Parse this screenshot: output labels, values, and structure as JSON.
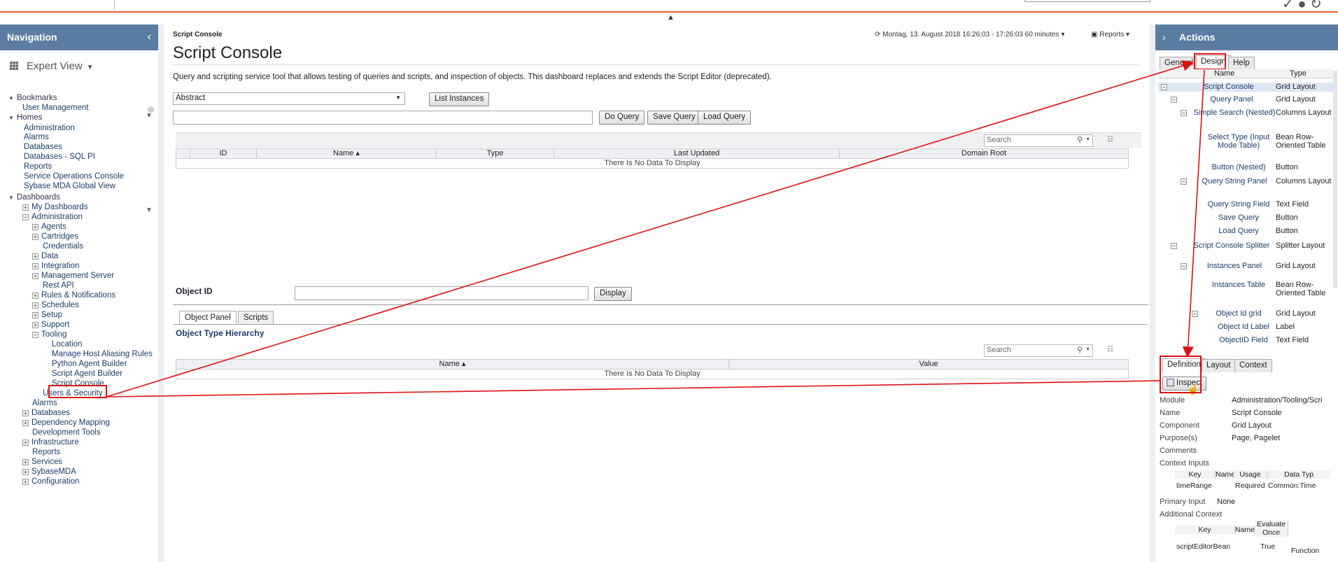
{
  "topbar": {
    "glyphs": "✓ ● ↻"
  },
  "nav": {
    "title": "Navigation",
    "expert_view": "Expert View",
    "tree": [
      {
        "text": "Bookmarks",
        "kind": "section"
      },
      {
        "text": "User Management",
        "kind": "item"
      },
      {
        "text": "Homes",
        "kind": "section"
      },
      {
        "text": "Administration",
        "kind": "item"
      },
      {
        "text": "Alarms",
        "kind": "item"
      },
      {
        "text": "Databases",
        "kind": "item"
      },
      {
        "text": "Databases - SQL PI",
        "kind": "item"
      },
      {
        "text": "Reports",
        "kind": "item"
      },
      {
        "text": "Service Operations Console",
        "kind": "item"
      },
      {
        "text": "Sybase MDA Global View",
        "kind": "item"
      },
      {
        "text": "Dashboards",
        "kind": "section"
      },
      {
        "text": "My Dashboards",
        "kind": "plus"
      },
      {
        "text": "Administration",
        "kind": "minus"
      },
      {
        "text": "Agents",
        "kind": "plus"
      },
      {
        "text": "Cartridges",
        "kind": "plus"
      },
      {
        "text": "Credentials",
        "kind": "item"
      },
      {
        "text": "Data",
        "kind": "plus"
      },
      {
        "text": "Integration",
        "kind": "plus"
      },
      {
        "text": "Management Server",
        "kind": "plus"
      },
      {
        "text": "Rest API",
        "kind": "item"
      },
      {
        "text": "Rules & Notifications",
        "kind": "plus"
      },
      {
        "text": "Schedules",
        "kind": "plus"
      },
      {
        "text": "Setup",
        "kind": "plus"
      },
      {
        "text": "Support",
        "kind": "plus"
      },
      {
        "text": "Tooling",
        "kind": "minus"
      },
      {
        "text": "Location",
        "kind": "item"
      },
      {
        "text": "Manage Host Aliasing Rules",
        "kind": "item"
      },
      {
        "text": "Python Agent Builder",
        "kind": "item"
      },
      {
        "text": "Script Agent Builder",
        "kind": "item"
      },
      {
        "text": "Script Console",
        "kind": "item"
      },
      {
        "text": "Users & Security",
        "kind": "item"
      },
      {
        "text": "Alarms",
        "kind": "item"
      },
      {
        "text": "Databases",
        "kind": "plus"
      },
      {
        "text": "Dependency Mapping",
        "kind": "plus"
      },
      {
        "text": "Development Tools",
        "kind": "item"
      },
      {
        "text": "Infrastructure",
        "kind": "plus"
      },
      {
        "text": "Reports",
        "kind": "item"
      },
      {
        "text": "Services",
        "kind": "plus"
      },
      {
        "text": "SybaseMDA",
        "kind": "plus"
      },
      {
        "text": "Configuration",
        "kind": "plus"
      }
    ]
  },
  "main": {
    "breadcrumb": "Script Console",
    "time_range": "⟳ Montag, 13. August 2018 16:26:03 - 17:26:03 60 minutes ▾",
    "reports_label": "Reports ▾",
    "title": "Script Console",
    "description": "Query and scripting service tool that allows testing of queries and scripts, and inspection of objects. This dashboard replaces and extends the Script Editor (deprecated).",
    "type_select": "Abstract",
    "list_instances": "List Instances",
    "do_query": "Do Query",
    "save_query": "Save Query",
    "load_query": "Load Query",
    "search_placeholder": "Search",
    "instances_columns": [
      "ID",
      "Name ▴",
      "Type",
      "Last Updated",
      "Domain Root"
    ],
    "no_data": "There Is No Data To Display",
    "object_id_label": "Object ID",
    "display": "Display",
    "tabs": [
      "Object Panel",
      "Scripts"
    ],
    "hierarchy_title": "Object Type Hierarchy",
    "hierarchy_columns": [
      "Name ▴",
      "Value"
    ]
  },
  "actions": {
    "title": "Actions",
    "tabs": [
      "General",
      "Design",
      "Help"
    ],
    "tree_columns": [
      "Name",
      "Type"
    ],
    "tree": [
      {
        "name": "Script Console",
        "type": "Grid Layout"
      },
      {
        "name": "Query Panel",
        "type": "Grid Layout"
      },
      {
        "name": "Simple Search (Nested)",
        "type": "Columns Layout"
      },
      {
        "name": "Select Type (Input Mode Table)",
        "type": "Bean Row-Oriented Table"
      },
      {
        "name": "Button (Nested)",
        "type": "Button"
      },
      {
        "name": "Query String Panel",
        "type": "Columns Layout"
      },
      {
        "name": "Query String Field",
        "type": "Text Field"
      },
      {
        "name": "Save Query",
        "type": "Button"
      },
      {
        "name": "Load Query",
        "type": "Button"
      },
      {
        "name": "Script Console Splitter",
        "type": "Splitter Layout"
      },
      {
        "name": "Instances Panel",
        "type": "Grid Layout"
      },
      {
        "name": "Instances Table",
        "type": "Bean Row-Oriented Table"
      },
      {
        "name": "Object Id grid",
        "type": "Grid Layout"
      },
      {
        "name": "Object Id Label",
        "type": "Label"
      },
      {
        "name": "ObjectID Field",
        "type": "Text Field"
      }
    ],
    "lower_tabs": [
      "Definition",
      "Layout",
      "Context"
    ],
    "inspect": "Inspect",
    "props": [
      {
        "k": "Module",
        "v": "Administration/Tooling/Scri"
      },
      {
        "k": "Name",
        "v": "Script Console"
      },
      {
        "k": "Component",
        "v": "Grid Layout"
      },
      {
        "k": "Purpose(s)",
        "v": "Page, Pagelet"
      },
      {
        "k": "Comments",
        "v": ""
      },
      {
        "k": "Context Inputs",
        "v": ""
      }
    ],
    "ctx_cols": [
      "Key",
      "Name",
      "Usage",
      "Data Typ"
    ],
    "ctx_row": [
      "timeRange",
      "",
      "Required",
      "Common:Time"
    ],
    "primary_input_label": "Primary Input",
    "primary_input_value": "None",
    "additional_context": "Additional Context",
    "add_cols": [
      "Key",
      "Name",
      "Evaluate Once"
    ],
    "add_row": [
      "scriptEditorBean",
      "",
      "True",
      "Function"
    ]
  },
  "colors": {
    "header": "#5b7da3",
    "annotation": "#dd1111",
    "accent_orange": "#e8622a"
  }
}
